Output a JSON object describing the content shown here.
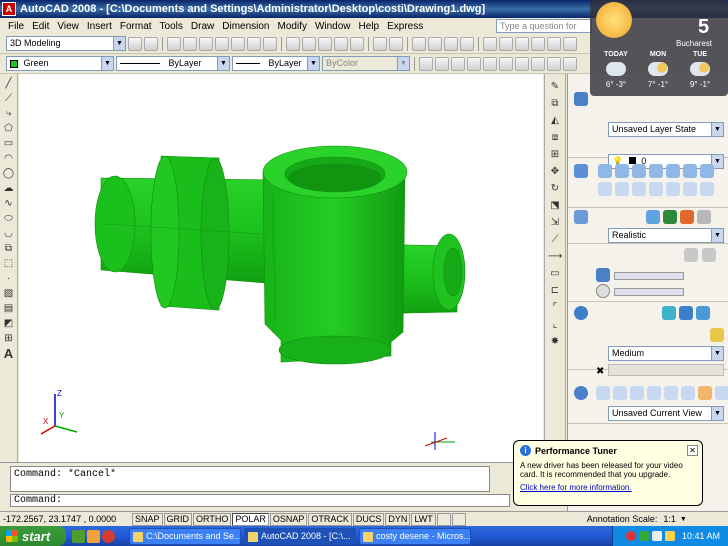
{
  "window": {
    "title": "AutoCAD 2008 - [C:\\Documents and Settings\\Administrator\\Desktop\\costi\\Drawing1.dwg]",
    "app_icon_letter": "A"
  },
  "menu": [
    "File",
    "Edit",
    "View",
    "Insert",
    "Format",
    "Tools",
    "Draw",
    "Dimension",
    "Modify",
    "Window",
    "Help",
    "Express"
  ],
  "help_search": {
    "placeholder": "Type a question for help"
  },
  "workspace": {
    "value": "3D Modeling"
  },
  "properties": {
    "color": "Green",
    "linetype": "ByLayer",
    "lineweight": "ByLayer",
    "plotstyle": "ByColor"
  },
  "weather": {
    "temp": "5",
    "city": "Bucharest",
    "days": [
      {
        "name": "TODAY",
        "temps": "6° -3°"
      },
      {
        "name": "MON",
        "temps": "7° -1°"
      },
      {
        "name": "TUE",
        "temps": "9° -1°"
      }
    ]
  },
  "dashboard": {
    "layer_state": "Unsaved Layer State",
    "layer_name": "0",
    "visual_style": "Realistic",
    "render_quality": "Medium",
    "view": "Unsaved Current View"
  },
  "command": {
    "history": "Command: *Cancel*",
    "prompt": "Command:"
  },
  "status": {
    "coords": "-172.2567, 23.1747 , 0.0000",
    "toggles": [
      {
        "label": "SNAP",
        "on": false
      },
      {
        "label": "GRID",
        "on": false
      },
      {
        "label": "ORTHO",
        "on": false
      },
      {
        "label": "POLAR",
        "on": true
      },
      {
        "label": "OSNAP",
        "on": false
      },
      {
        "label": "OTRACK",
        "on": false
      },
      {
        "label": "DUCS",
        "on": false
      },
      {
        "label": "DYN",
        "on": false
      },
      {
        "label": "LWT",
        "on": false
      }
    ],
    "annotation_scale_label": "Annotation Scale:",
    "annotation_scale_value": "1:1"
  },
  "balloon": {
    "title": "Performance Tuner",
    "message": "A new driver has been released for your video card. It is recommended that you upgrade.",
    "link": "Click here for more information."
  },
  "taskbar": {
    "start": "start",
    "tasks": [
      {
        "label": "C:\\Documents and Se..."
      },
      {
        "label": "AutoCAD 2008 - [C:\\..."
      },
      {
        "label": "costy desene - Micros..."
      }
    ],
    "clock": "10:41 AM"
  },
  "ucs": {
    "x": "X",
    "y": "Y",
    "z": "Z"
  },
  "colors": {
    "model_green": "#1fc21f",
    "model_dark": "#0e8f0e",
    "title_blue": "#0a246a"
  }
}
